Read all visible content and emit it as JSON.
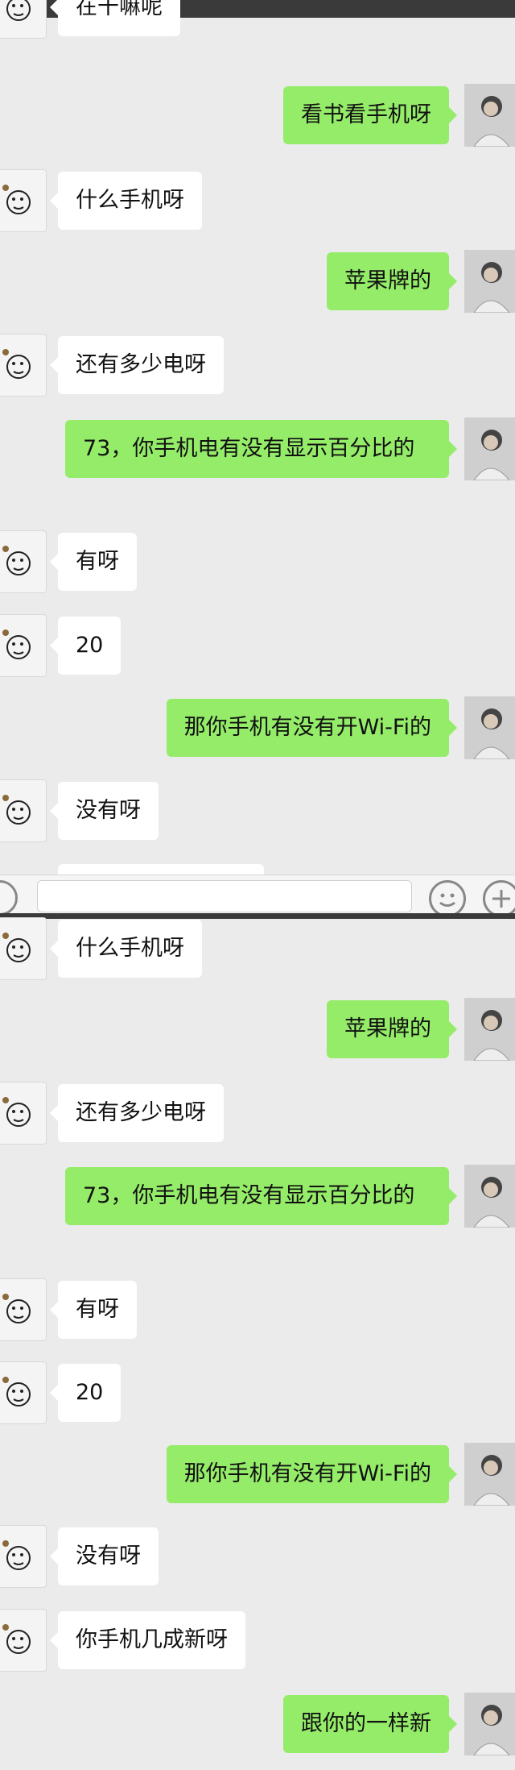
{
  "chat": {
    "top": [
      {
        "side": "left",
        "text": "在干嘛呢"
      },
      {
        "side": "right",
        "text": "看书看手机呀"
      },
      {
        "side": "left",
        "text": "什么手机呀"
      },
      {
        "side": "right",
        "text": "苹果牌的"
      },
      {
        "side": "left",
        "text": "还有多少电呀"
      },
      {
        "side": "right",
        "text": "73，你手机电有没有显示百分比的"
      },
      {
        "side": "left",
        "text": "有呀"
      },
      {
        "side": "left",
        "text": "20"
      },
      {
        "side": "right",
        "text": "那你手机有没有开Wi-Fi的"
      },
      {
        "side": "left",
        "text": "没有呀"
      }
    ],
    "bottom": [
      {
        "side": "left",
        "text": "什么手机呀"
      },
      {
        "side": "right",
        "text": "苹果牌的"
      },
      {
        "side": "left",
        "text": "还有多少电呀"
      },
      {
        "side": "right",
        "text": "73，你手机电有没有显示百分比的"
      },
      {
        "side": "left",
        "text": "有呀"
      },
      {
        "side": "left",
        "text": "20"
      },
      {
        "side": "right",
        "text": "那你手机有没有开Wi-Fi的"
      },
      {
        "side": "left",
        "text": "没有呀"
      },
      {
        "side": "left",
        "text": "你手机几成新呀"
      },
      {
        "side": "right",
        "text": "跟你的一样新"
      }
    ]
  },
  "input_bar": {
    "voice_icon": "voice-icon",
    "emoji_icon": "emoji-icon",
    "plus_icon": "plus-icon"
  },
  "colors": {
    "background": "#ebebeb",
    "outgoing_bubble": "#95ec69",
    "incoming_bubble": "#ffffff"
  }
}
